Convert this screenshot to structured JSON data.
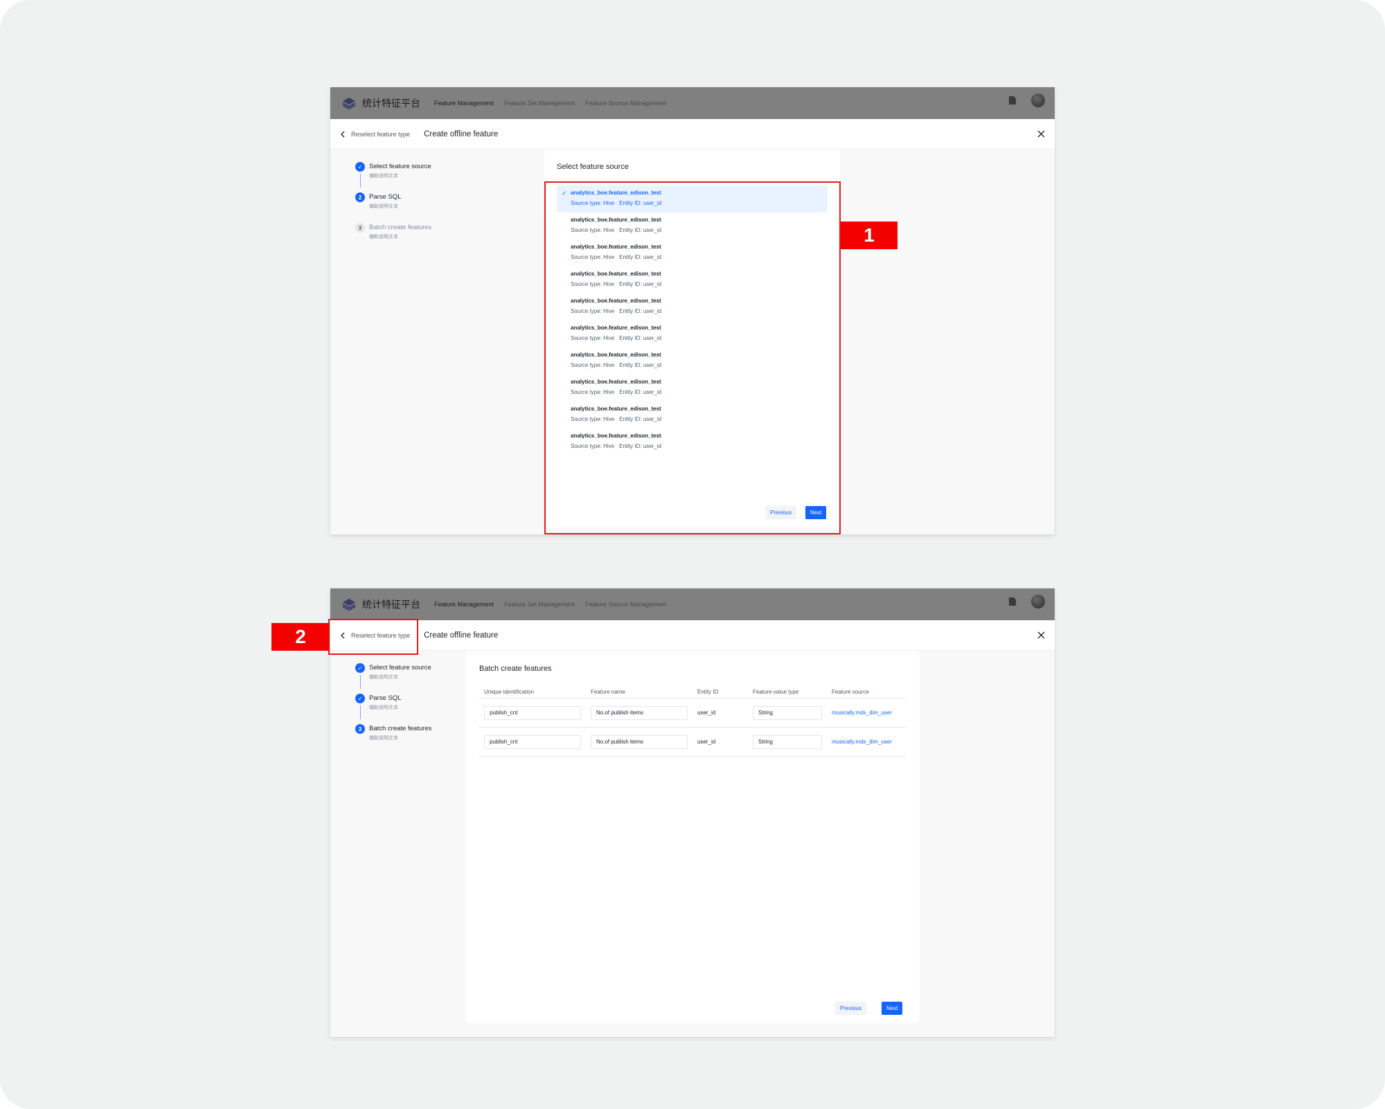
{
  "app": {
    "brand": "统计特征平台",
    "nav": [
      "Feature Management",
      "Feature Set Management",
      "Feature Source Management"
    ]
  },
  "header": {
    "back_label": "Reselect feature type",
    "title": "Create offline feature"
  },
  "steps": [
    {
      "title": "Select feature source",
      "sub": "辅助说明文本",
      "num": "1"
    },
    {
      "title": "Parse SQL",
      "sub": "辅助说明文本",
      "num": "2"
    },
    {
      "title": "Batch create features",
      "sub": "辅助说明文本",
      "num": "3"
    }
  ],
  "screen1": {
    "panel_title": "Select feature source",
    "sources": [
      {
        "name": "analytics_boe.feature_edison_test",
        "type": "Source type: Hive",
        "entity": "Entity ID: user_id",
        "selected": true
      },
      {
        "name": "analytics_boe.feature_edison_test",
        "type": "Source type: Hive",
        "entity": "Entity ID: user_id",
        "selected": false
      },
      {
        "name": "analytics_boe.feature_edison_test",
        "type": "Source type: Hive",
        "entity": "Entity ID: user_id",
        "selected": false
      },
      {
        "name": "analytics_boe.feature_edison_test",
        "type": "Source type: Hive",
        "entity": "Entity ID: user_id",
        "selected": false
      },
      {
        "name": "analytics_boe.feature_edison_test",
        "type": "Source type: Hive",
        "entity": "Entity ID: user_id",
        "selected": false
      },
      {
        "name": "analytics_boe.feature_edison_test",
        "type": "Source type: Hive",
        "entity": "Entity ID: user_id",
        "selected": false
      },
      {
        "name": "analytics_boe.feature_edison_test",
        "type": "Source type: Hive",
        "entity": "Entity ID: user_id",
        "selected": false
      },
      {
        "name": "analytics_boe.feature_edison_test",
        "type": "Source type: Hive",
        "entity": "Entity ID: user_id",
        "selected": false
      },
      {
        "name": "analytics_boe.feature_edison_test",
        "type": "Source type: Hive",
        "entity": "Entity ID: user_id",
        "selected": false
      },
      {
        "name": "analytics_boe.feature_edison_test",
        "type": "Source type: Hive",
        "entity": "Entity ID: user_id",
        "selected": false
      }
    ],
    "prev_label": "Previous",
    "next_label": "Next"
  },
  "screen2": {
    "panel_title": "Batch create features",
    "columns": [
      "Unique identification",
      "Feature name",
      "Entity ID",
      "Feature value type",
      "Feature source"
    ],
    "rows": [
      {
        "uid": "publish_cnt",
        "name": "No.of publish items",
        "entity": "user_id",
        "value_type": "String",
        "source": "musically.mds_dim_user"
      },
      {
        "uid": "publish_cnt",
        "name": "No.of publish items",
        "entity": "user_id",
        "value_type": "String",
        "source": "musically.mds_dim_user"
      }
    ],
    "prev_label": "Previous",
    "next_label": "Next"
  },
  "annotations": {
    "marker1": "1",
    "marker2": "2"
  },
  "colors": {
    "accent": "#1664ff",
    "marker": "#f30000",
    "topbar": "#808080"
  },
  "icons": [
    "logo-icon",
    "chevron-left-icon",
    "close-icon",
    "document-icon",
    "check-icon"
  ]
}
